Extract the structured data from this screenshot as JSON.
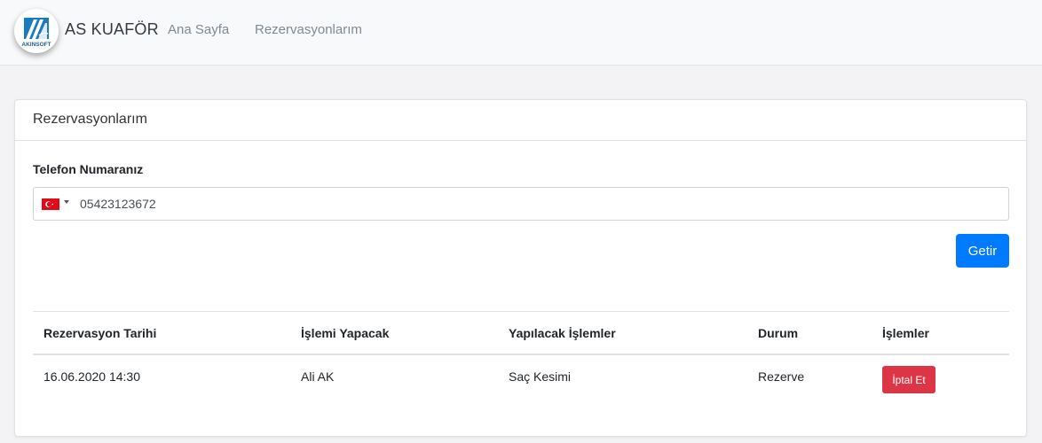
{
  "navbar": {
    "logo_text": "AKINSOFT",
    "brand": "AS KUAFÖR",
    "links": [
      {
        "label": "Ana Sayfa"
      },
      {
        "label": "Rezervasyonlarım"
      }
    ]
  },
  "card": {
    "title": "Rezervasyonlarım",
    "phone_label": "Telefon Numaranız",
    "phone_value": "05423123672",
    "phone_country_icon": "turkey-flag-icon",
    "submit_label": "Getir"
  },
  "table": {
    "headers": [
      "Rezervasyon Tarihi",
      "İşlemi Yapacak",
      "Yapılacak İşlemler",
      "Durum",
      "İşlemler"
    ],
    "rows": [
      {
        "date": "16.06.2020 14:30",
        "staff": "Ali AK",
        "services": "Saç Kesimi",
        "status": "Rezerve",
        "action_label": "İptal Et"
      }
    ]
  },
  "colors": {
    "primary": "#007bff",
    "danger": "#dc3545",
    "navbar_bg": "#f8f9fa",
    "page_bg": "#f3f3f6"
  }
}
